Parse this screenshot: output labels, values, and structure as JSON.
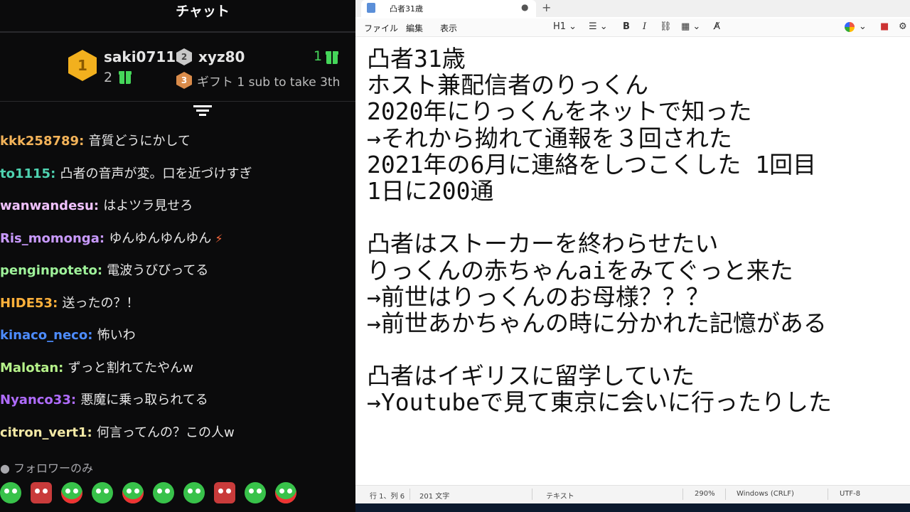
{
  "chat": {
    "title": "チャット",
    "leaderboard": {
      "first": {
        "rank": "1",
        "name": "saki0711",
        "count": "2"
      },
      "second": {
        "rank": "2",
        "name": "xyz80",
        "count": "1"
      },
      "third": {
        "rank": "3",
        "text": "ギフト 1 sub to take 3th"
      }
    },
    "messages": [
      {
        "user": "kkk258789",
        "color": "#f3b359",
        "text": "音質どうにかして"
      },
      {
        "user": "to1115",
        "color": "#4fd3b1",
        "text": "凸者の音声が変。口を近づけすぎ"
      },
      {
        "user": "wanwandesu",
        "color": "#f1c2ff",
        "text": "はよツラ見せろ"
      },
      {
        "user": "Ris_momonga",
        "color": "#c99aff",
        "text": "ゆんゆんゆんゆん"
      },
      {
        "user": "penginpoteto",
        "color": "#9ff29a",
        "text": "電波うびびってる"
      },
      {
        "user": "HIDE53",
        "color": "#ffb13b",
        "text": "送ったの？！"
      },
      {
        "user": "kinaco_neco",
        "color": "#4d8cff",
        "text": "怖いわ"
      },
      {
        "user": "Malotan",
        "color": "#b6f28a",
        "text": "ずっと割れてたやんw"
      },
      {
        "user": "Nyanco33",
        "color": "#b06cff",
        "text": "悪魔に乗っ取られてる"
      },
      {
        "user": "citron_vert1",
        "color": "#f3e9a6",
        "text": "何言ってんの？この人w"
      }
    ],
    "followers_only": "フォロワーのみ"
  },
  "notepad": {
    "tab_title": "凸者31歳",
    "menu": {
      "file": "ファイル",
      "edit": "編集",
      "view": "表示"
    },
    "toolbar": {
      "heading": "H1",
      "bold": "B",
      "italic": "I"
    },
    "document_lines": [
      "凸者31歳",
      "ホスト兼配信者のりっくん",
      "2020年にりっくんをネットで知った",
      "→それから拗れて通報を３回された",
      "2021年の6月に連絡をしつこくした 1回目",
      "1日に200通",
      "",
      "凸者はストーカーを終わらせたい",
      "りっくんの赤ちゃんaiをみてぐっと来た",
      "→前世はりっくんのお母様？？？",
      "→前世あかちゃんの時に分かれた記憶がある",
      "",
      "凸者はイギリスに留学していた",
      "→Youtubeで見て東京に会いに行ったりした"
    ],
    "status": {
      "position": "行 1、列 6",
      "chars": "201 文字",
      "format": "テキスト",
      "zoom": "290%",
      "line_ending": "Windows (CRLF)",
      "encoding": "UTF-8"
    }
  }
}
